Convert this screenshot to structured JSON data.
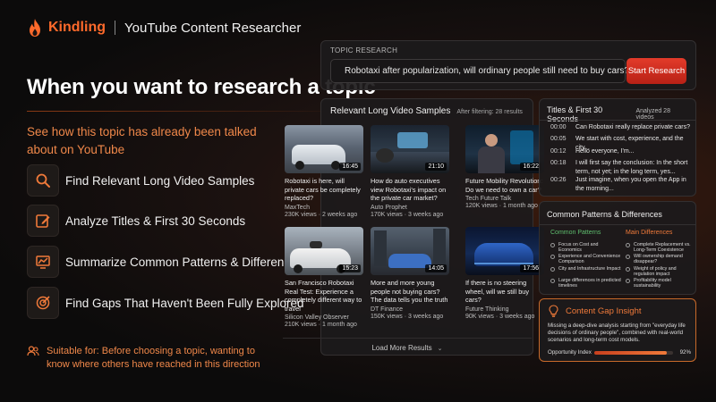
{
  "header": {
    "brand": "Kindling",
    "app_name": "YouTube Content Researcher"
  },
  "hero": {
    "title": "When you want to research a topic",
    "subtitle": "See how this topic has already been talked about on YouTube"
  },
  "features": [
    {
      "label": "Find Relevant Long Video Samples",
      "icon": "search-icon"
    },
    {
      "label": "Analyze Titles & First 30 Seconds",
      "icon": "edit-icon"
    },
    {
      "label": "Summarize Common Patterns & Differences",
      "icon": "chart-icon"
    },
    {
      "label": "Find Gaps That Haven't Been Fully Explored",
      "icon": "target-icon"
    }
  ],
  "suitable": "Suitable for: Before choosing a topic, wanting to know where others have reached in this direction",
  "search": {
    "label": "TOPIC RESEARCH",
    "value": "Robotaxi after popularization, will ordinary people still need to buy cars?",
    "button": "Start Research"
  },
  "videos": {
    "title": "Relevant Long Video Samples",
    "filter": "After filtering: 28 results",
    "items": [
      {
        "title": "Robotaxi is here, will private cars be completely replaced?",
        "channel": "MaxTech",
        "stats": "230K views · 2 weeks ago",
        "duration": "16:45"
      },
      {
        "title": "How do auto executives view Robotaxi's impact on the private car market?",
        "channel": "Auto Prophet",
        "stats": "170K views · 3 weeks ago",
        "duration": "21:10"
      },
      {
        "title": "Future Mobility Revolution: Do we need to own a car?",
        "channel": "Tech Future Talk",
        "stats": "120K views · 1 month ago",
        "duration": "16:22"
      },
      {
        "title": "San Francisco Robotaxi Real Test: Experience a completely different way to travel",
        "channel": "Silicon Valley Observer",
        "stats": "210K views · 1 month ago",
        "duration": "15:23"
      },
      {
        "title": "More and more young people not buying cars? The data tells you the truth",
        "channel": "DT Finance",
        "stats": "150K views · 3 weeks ago",
        "duration": "14:05"
      },
      {
        "title": "If there is no steering wheel, will we still buy cars?",
        "channel": "Future Thinking",
        "stats": "90K views · 3 weeks ago",
        "duration": "17:56"
      }
    ],
    "load_more": "Load More Results"
  },
  "titles": {
    "title": "Titles & First 30 Seconds",
    "count": "Analyzed 28 videos",
    "rows": [
      {
        "ts": "00:00",
        "text": "Can Robotaxi really replace private cars?"
      },
      {
        "ts": "00:05",
        "text": "We start with cost, experience, and the city..."
      },
      {
        "ts": "00:12",
        "text": "Hello everyone, I'm..."
      },
      {
        "ts": "00:18",
        "text": "I will first say the conclusion: In the short term, not yet; in the long term, yes..."
      },
      {
        "ts": "00:26",
        "text": "Just imagine, when you open the App in the morning..."
      }
    ]
  },
  "patterns": {
    "title": "Common Patterns & Differences",
    "common_label": "Common Patterns",
    "diff_label": "Main Differences",
    "common": [
      "Focus on Cost and Economics",
      "Experience and Convenience Comparison",
      "City and Infrastructure Impact",
      "Large differences in predicted timelines"
    ],
    "differences": [
      "Complete Replacement vs. Long-Term Coexistence",
      "Will ownership demand disappear?",
      "Weight of policy and regulation impact",
      "Profitability model sustainability"
    ]
  },
  "gap": {
    "title": "Content Gap Insight",
    "text": "Missing a deep-dive analysis starting from \"everyday life decisions of ordinary people\", combined with real-world scenarios and long-term cost models.",
    "index_label": "Opportunity Index",
    "index_value": "92%",
    "index_fraction": 0.92
  },
  "colors": {
    "accent": "#f07a3a",
    "brand": "#ff6a2b",
    "button": "#d4301f"
  }
}
